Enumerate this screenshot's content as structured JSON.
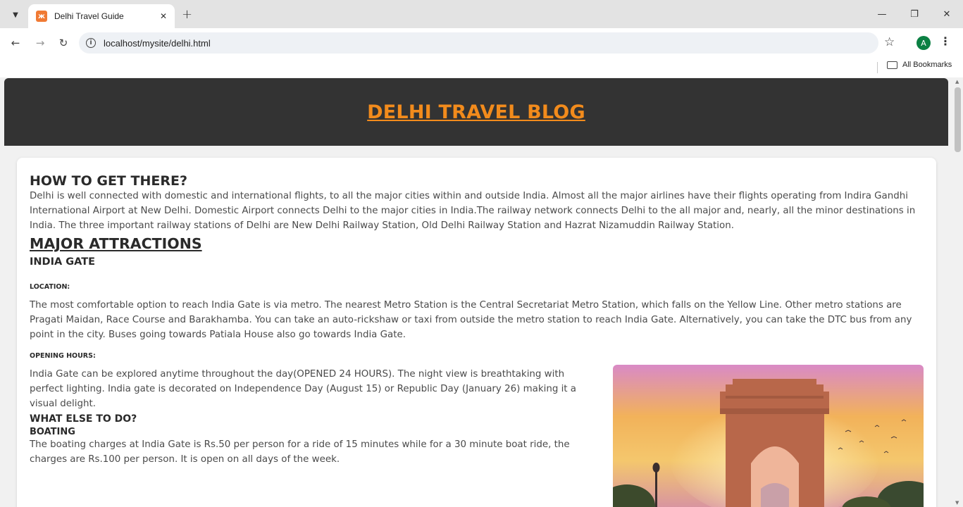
{
  "browser": {
    "tab_title": "Delhi Travel Guide",
    "url": "localhost/mysite/delhi.html",
    "bookmarks_label": "All Bookmarks",
    "profile_initial": "A"
  },
  "page": {
    "site_title": "DELHI TRAVEL BLOG",
    "get_there": {
      "heading": "HOW TO GET THERE?",
      "text": "Delhi is well connected with domestic and international flights, to all the major cities within and outside India. Almost all the major airlines have their flights operating from Indira Gandhi International Airport at New Delhi. Domestic Airport connects Delhi to the major cities in India.The railway network connects Delhi to the all major and, nearly, all the minor destinations in India. The three important railway stations of Delhi are New Delhi Railway Station, Old Delhi Railway Station and Hazrat Nizamuddin Railway Station."
    },
    "attractions": {
      "heading": "MAJOR ATTRACTIONS",
      "place": "INDIA GATE",
      "location_label": "LOCATION:",
      "location_text": "The most comfortable option to reach India Gate is via metro. The nearest Metro Station is the Central Secretariat Metro Station, which falls on the Yellow Line. Other metro stations are Pragati Maidan, Race Course and Barakhamba. You can take an auto-rickshaw or taxi from outside the metro station to reach India Gate. Alternatively, you can take the DTC bus from any point in the city. Buses going towards Patiala House also go towards India Gate.",
      "hours_label": "OPENING HOURS:",
      "hours_text": "India Gate can be explored anytime throughout the day(OPENED 24 HOURS). The night view is breathtaking with perfect lighting. India gate is decorated on Independence Day (August 15) or Republic Day (January 26) making it a visual delight.",
      "else_heading": "WHAT ELSE TO DO?",
      "boating_heading": "BOATING",
      "boating_text": "The boating charges at India Gate is Rs.50 per person for a ride of 15 minutes while for a 30 minute boat ride, the charges are Rs.100 per person. It is open on all days of the week."
    }
  },
  "icons": {
    "tab_menu": "chevron-down-icon",
    "favicon": "xampp-icon",
    "tab_close": "close-icon",
    "new_tab": "plus-icon",
    "back": "arrow-left-icon",
    "forward": "arrow-right-icon",
    "reload": "reload-icon",
    "site_info": "info-icon",
    "bookmark": "star-icon",
    "menu": "kebab-icon",
    "folder": "folder-icon"
  },
  "colors": {
    "header_bg": "#333333",
    "title_orange": "#f28b1c",
    "page_bg": "#f1f1f1",
    "card_bg": "#ffffff",
    "avatar": "#0b8043"
  }
}
